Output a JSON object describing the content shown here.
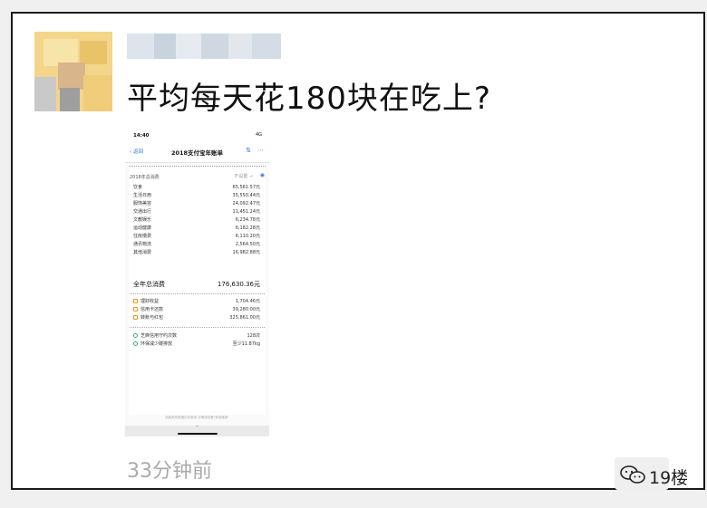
{
  "post": {
    "text": "平均每天花180块在吃上?",
    "timestamp": "33分钟前"
  },
  "watermark": {
    "icon": "wechat-icon",
    "text": "19楼"
  },
  "screenshot": {
    "status_time": "14:40",
    "status_network": "4G",
    "back_label": "返回",
    "title": "2018支付宝年账单",
    "section_title": "2018年总消费",
    "toggle_label": "不设置",
    "categories": [
      {
        "label": "饮食",
        "amount": "65,561.57元"
      },
      {
        "label": "生活日用",
        "amount": "35,550.44元"
      },
      {
        "label": "服饰美容",
        "amount": "24,092.47元"
      },
      {
        "label": "交通出行",
        "amount": "11,451.24元"
      },
      {
        "label": "文教娱乐",
        "amount": "6,234.78元"
      },
      {
        "label": "运动健康",
        "amount": "6,182.28元"
      },
      {
        "label": "住房缴费",
        "amount": "6,110.20元"
      },
      {
        "label": "通讯物流",
        "amount": "2,564.50元"
      },
      {
        "label": "其他消费",
        "amount": "16,982.88元"
      }
    ],
    "total_label": "全年总消费",
    "total_amount": "176,630.36元",
    "finance": [
      {
        "label": "理财收益",
        "amount": "1,704.46元"
      },
      {
        "label": "信用卡还款",
        "amount": "39,280.00元"
      },
      {
        "label": "转账与红包",
        "amount": "325,861.00元"
      }
    ],
    "green": [
      {
        "label": "芝麻信用守约次数",
        "amount": "128次"
      },
      {
        "label": "环保减少碳排放",
        "amount": "至少11.87kg"
      }
    ],
    "footer_note": "消费类别数据仅供参考,详情请查看\"我的账单\""
  }
}
